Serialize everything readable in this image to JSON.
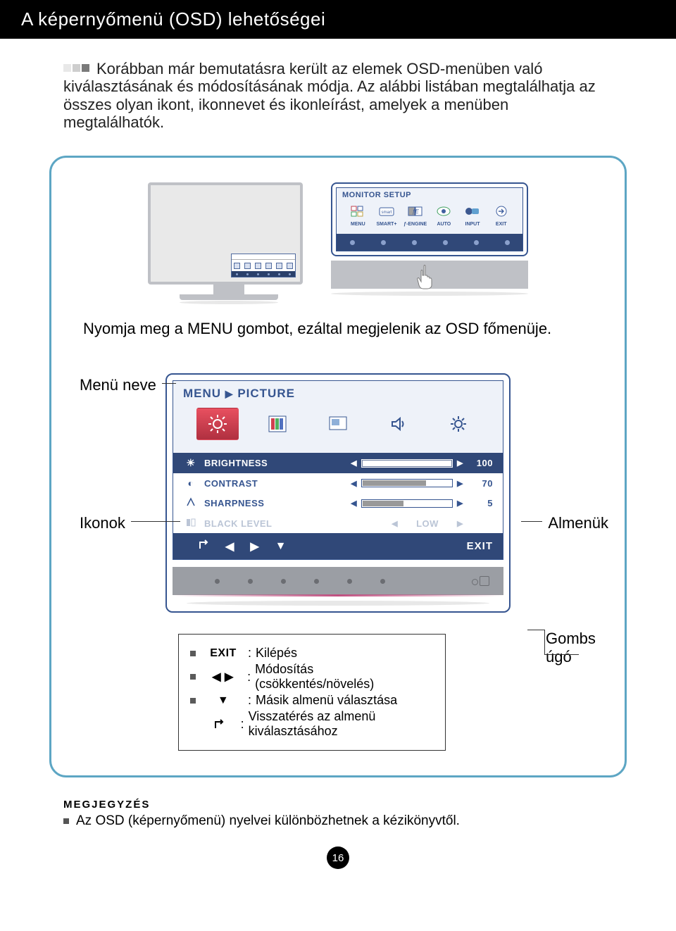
{
  "header": {
    "title": "A képernyőmenü (OSD) lehetőségei"
  },
  "intro": "Korábban már bemutatásra került az elemek OSD-menüben való kiválasztásának és módosításának módja. Az alábbi listában megtalálhatja az összes olyan ikont, ikonnevet és ikonleírást, amelyek a menüben megtalálhatók.",
  "upper_osd": {
    "title": "MONITOR SETUP",
    "labels": [
      "MENU",
      "SMART+",
      "ƒ-ENGINE",
      "AUTO",
      "INPUT",
      "EXIT"
    ]
  },
  "under_text": "Nyomja meg a MENU gombot, ezáltal megjelenik az OSD főmenüje.",
  "labels": {
    "menu_name": "Menü neve",
    "icons": "Ikonok",
    "submenus": "Almenük",
    "button_hint": "Gombs úgó"
  },
  "big_osd": {
    "breadcrumb_menu": "MENU",
    "breadcrumb_section": "PICTURE",
    "rows": [
      {
        "icon": "brightness",
        "label": "BRIGHTNESS",
        "value": "100",
        "fill": 100,
        "hl": true
      },
      {
        "icon": "contrast",
        "label": "CONTRAST",
        "value": "70",
        "fill": 70,
        "hl": false
      },
      {
        "icon": "sharpness",
        "label": "SHARPNESS",
        "value": "5",
        "fill": 45,
        "hl": false
      },
      {
        "icon": "blacklevel",
        "label": "BLACK LEVEL",
        "text_value": "LOW",
        "dim": true
      }
    ],
    "footer_exit": "EXIT"
  },
  "legend": {
    "exit_key": "EXIT",
    "items": [
      "Kilépés",
      "Módosítás (csökkentés/növelés)",
      "Másik almenü választása",
      "Visszatérés az almenü kiválasztásához"
    ]
  },
  "note": {
    "heading": "MEGJEGYZÉS",
    "text": "Az OSD (képernyőmenü) nyelvei különbözhetnek a kézikönyvtől."
  },
  "page_number": "16"
}
